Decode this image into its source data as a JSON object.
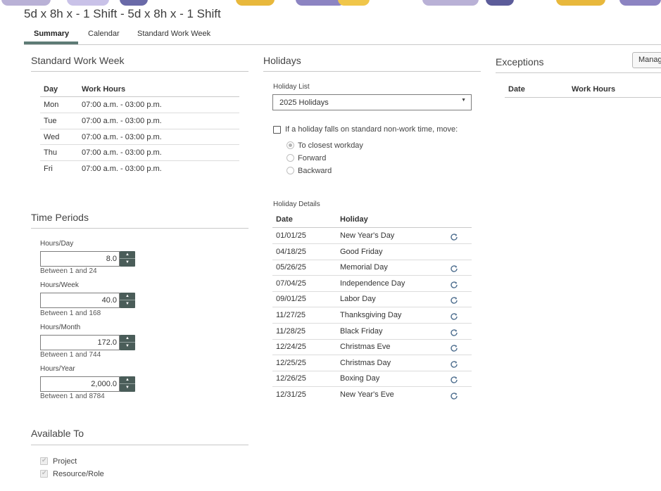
{
  "banner_colors": [
    "#b9b1d6",
    "#e8b83c",
    "#6a6aa8",
    "#f0c64a",
    "#8c84c2",
    "#d9a93a",
    "#5c5c9a",
    "#c9c2e8"
  ],
  "page_title": "5d x 8h x - 1 Shift - 5d x 8h x - 1 Shift",
  "tabs": [
    {
      "label": "Summary",
      "active": true
    },
    {
      "label": "Calendar",
      "active": false
    },
    {
      "label": "Standard Work Week",
      "active": false
    }
  ],
  "standard_work_week": {
    "title": "Standard Work Week",
    "headers": {
      "day": "Day",
      "work_hours": "Work Hours"
    },
    "rows": [
      {
        "day": "Mon",
        "hours": "07:00 a.m. - 03:00 p.m."
      },
      {
        "day": "Tue",
        "hours": "07:00 a.m. - 03:00 p.m."
      },
      {
        "day": "Wed",
        "hours": "07:00 a.m. - 03:00 p.m."
      },
      {
        "day": "Thu",
        "hours": "07:00 a.m. - 03:00 p.m."
      },
      {
        "day": "Fri",
        "hours": "07:00 a.m. - 03:00 p.m."
      }
    ]
  },
  "time_periods": {
    "title": "Time Periods",
    "fields": [
      {
        "label": "Hours/Day",
        "value": "8.0",
        "hint": "Between 1 and 24"
      },
      {
        "label": "Hours/Week",
        "value": "40.0",
        "hint": "Between 1 and 168"
      },
      {
        "label": "Hours/Month",
        "value": "172.0",
        "hint": "Between 1 and 744"
      },
      {
        "label": "Hours/Year",
        "value": "2,000.0",
        "hint": "Between 1 and 8784"
      }
    ]
  },
  "available_to": {
    "title": "Available To",
    "options": [
      {
        "label": "Project",
        "checked": true
      },
      {
        "label": "Resource/Role",
        "checked": true
      }
    ]
  },
  "holidays": {
    "title": "Holidays",
    "list_label": "Holiday List",
    "list_value": "2025 Holidays",
    "move_label": "If a holiday falls on standard non-work time, move:",
    "move_options": [
      {
        "label": "To closest workday",
        "checked": true
      },
      {
        "label": "Forward",
        "checked": false
      },
      {
        "label": "Backward",
        "checked": false
      }
    ],
    "details_label": "Holiday Details",
    "headers": {
      "date": "Date",
      "holiday": "Holiday"
    },
    "rows": [
      {
        "date": "01/01/25",
        "holiday": "New Year's Day",
        "recurring": true
      },
      {
        "date": "04/18/25",
        "holiday": "Good Friday",
        "recurring": false
      },
      {
        "date": "05/26/25",
        "holiday": "Memorial Day",
        "recurring": true
      },
      {
        "date": "07/04/25",
        "holiday": "Independence Day",
        "recurring": true
      },
      {
        "date": "09/01/25",
        "holiday": "Labor Day",
        "recurring": true
      },
      {
        "date": "11/27/25",
        "holiday": "Thanksgiving Day",
        "recurring": true
      },
      {
        "date": "11/28/25",
        "holiday": "Black Friday",
        "recurring": true
      },
      {
        "date": "12/24/25",
        "holiday": "Christmas Eve",
        "recurring": true
      },
      {
        "date": "12/25/25",
        "holiday": "Christmas Day",
        "recurring": true
      },
      {
        "date": "12/26/25",
        "holiday": "Boxing Day",
        "recurring": true
      },
      {
        "date": "12/31/25",
        "holiday": "New Year's Eve",
        "recurring": true
      }
    ]
  },
  "exceptions": {
    "title": "Exceptions",
    "manage_label": "Manage",
    "headers": {
      "date": "Date",
      "work_hours": "Work Hours"
    }
  }
}
